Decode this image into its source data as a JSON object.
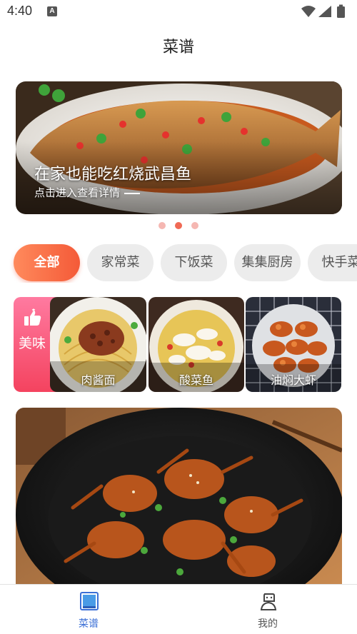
{
  "status_bar": {
    "time": "4:40",
    "notification": "A"
  },
  "header": {
    "title": "菜谱"
  },
  "banner": {
    "title": "在家也能吃红烧武昌鱼",
    "subtitle": "点击进入查看详情",
    "page_count": 3,
    "active_page": 2
  },
  "categories": [
    "全部",
    "家常菜",
    "下饭菜",
    "集集厨房",
    "快手菜"
  ],
  "featured": {
    "badge_label": "美味",
    "dishes": [
      "肉酱面",
      "酸菜鱼",
      "油焖大虾"
    ]
  },
  "bottom_nav": [
    {
      "label": "菜谱",
      "icon": "recipe-icon",
      "active": true
    },
    {
      "label": "我的",
      "icon": "profile-icon",
      "active": false
    }
  ],
  "colors": {
    "accent": "#f45a38",
    "badge": "#f4435f",
    "nav_active": "#3b6fd6",
    "dot_active": "#f06a55",
    "dot_inactive": "#f5b7b2"
  }
}
